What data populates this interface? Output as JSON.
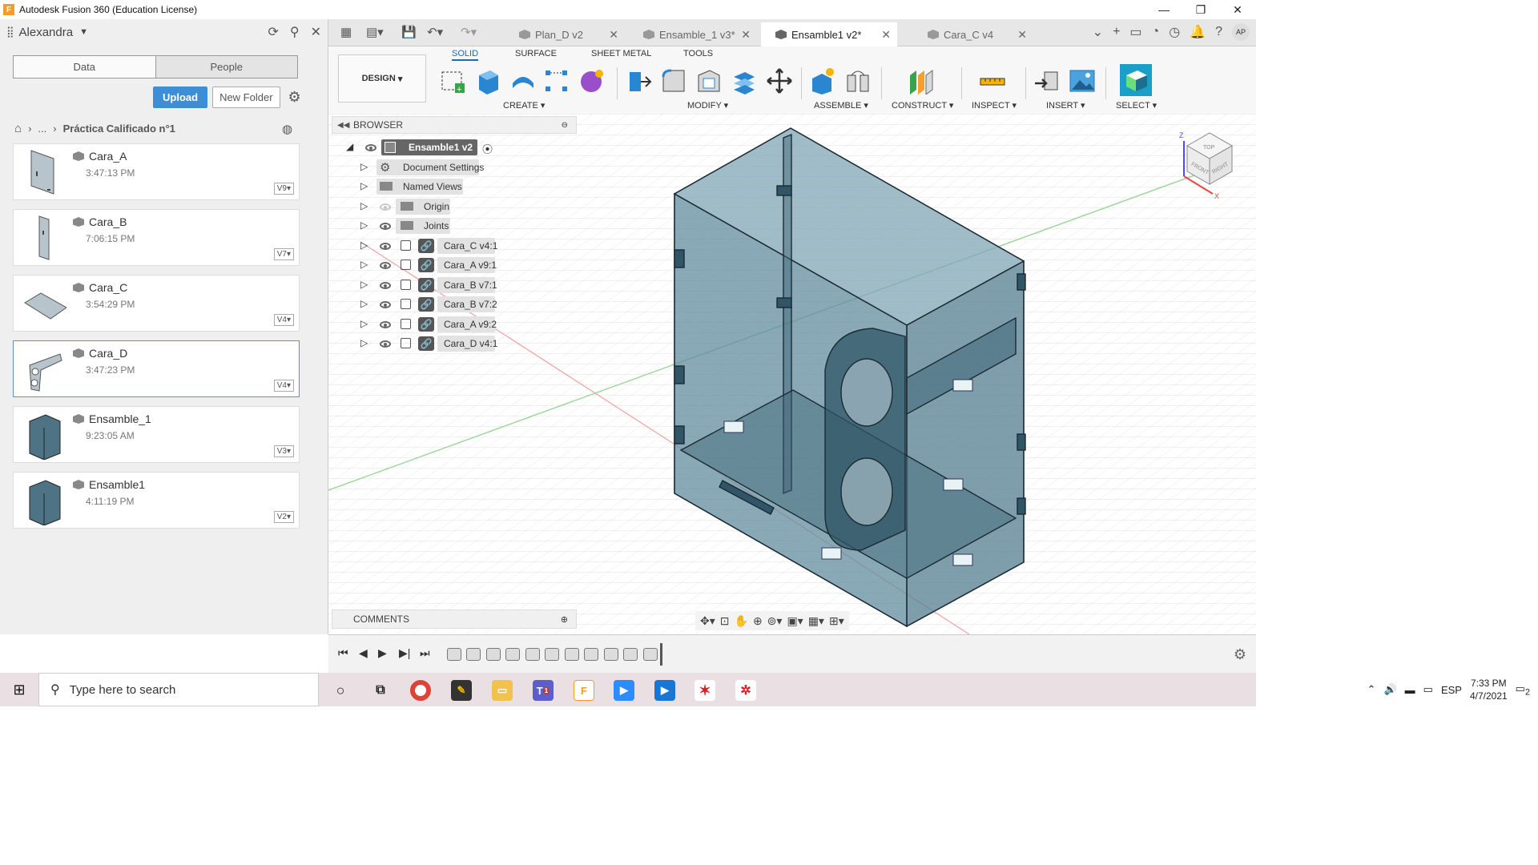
{
  "window": {
    "title": "Autodesk Fusion 360 (Education License)",
    "logo": "F"
  },
  "data_panel": {
    "user": "Alexandra",
    "tabs": [
      "Data",
      "People"
    ],
    "upload_label": "Upload",
    "new_folder_label": "New Folder",
    "breadcrumb_ellipsis": "...",
    "breadcrumb_title": "Práctica Calificado n°1",
    "files": [
      {
        "name": "Cara_A",
        "time": "3:47:13 PM",
        "version": "V9"
      },
      {
        "name": "Cara_B",
        "time": "7:06:15 PM",
        "version": "V7"
      },
      {
        "name": "Cara_C",
        "time": "3:54:29 PM",
        "version": "V4"
      },
      {
        "name": "Cara_D",
        "time": "3:47:23 PM",
        "version": "V4"
      },
      {
        "name": "Ensamble_1",
        "time": "9:23:05 AM",
        "version": "V3"
      },
      {
        "name": "Ensamble1",
        "time": "4:11:19 PM",
        "version": "V2"
      }
    ]
  },
  "doc_tabs": [
    {
      "label": "Plan_D v2"
    },
    {
      "label": "Ensamble_1 v3*"
    },
    {
      "label": "Ensamble1 v2*"
    },
    {
      "label": "Cara_C v4"
    }
  ],
  "user_initials": "AP",
  "toolbar": {
    "workspace": "DESIGN",
    "modes": [
      "SOLID",
      "SURFACE",
      "SHEET METAL",
      "TOOLS"
    ],
    "groups": [
      "CREATE",
      "MODIFY",
      "ASSEMBLE",
      "CONSTRUCT",
      "INSPECT",
      "INSERT",
      "SELECT"
    ]
  },
  "browser": {
    "title": "BROWSER",
    "root": "Ensamble1 v2",
    "items": [
      "Document Settings",
      "Named Views",
      "Origin",
      "Joints",
      "Cara_C v4:1",
      "Cara_A v9:1",
      "Cara_B v7:1",
      "Cara_B v7:2",
      "Cara_A v9:2",
      "Cara_D v4:1"
    ]
  },
  "comments_title": "COMMENTS",
  "viewcube": {
    "top": "TOP",
    "front": "FRONT",
    "right": "RIGHT",
    "axis_z": "Z",
    "axis_x": "X"
  },
  "taskbar": {
    "search_placeholder": "Type here to search",
    "language": "ESP",
    "time": "7:33 PM",
    "date": "4/7/2021",
    "notifications": "2",
    "teams_badge": "1"
  }
}
